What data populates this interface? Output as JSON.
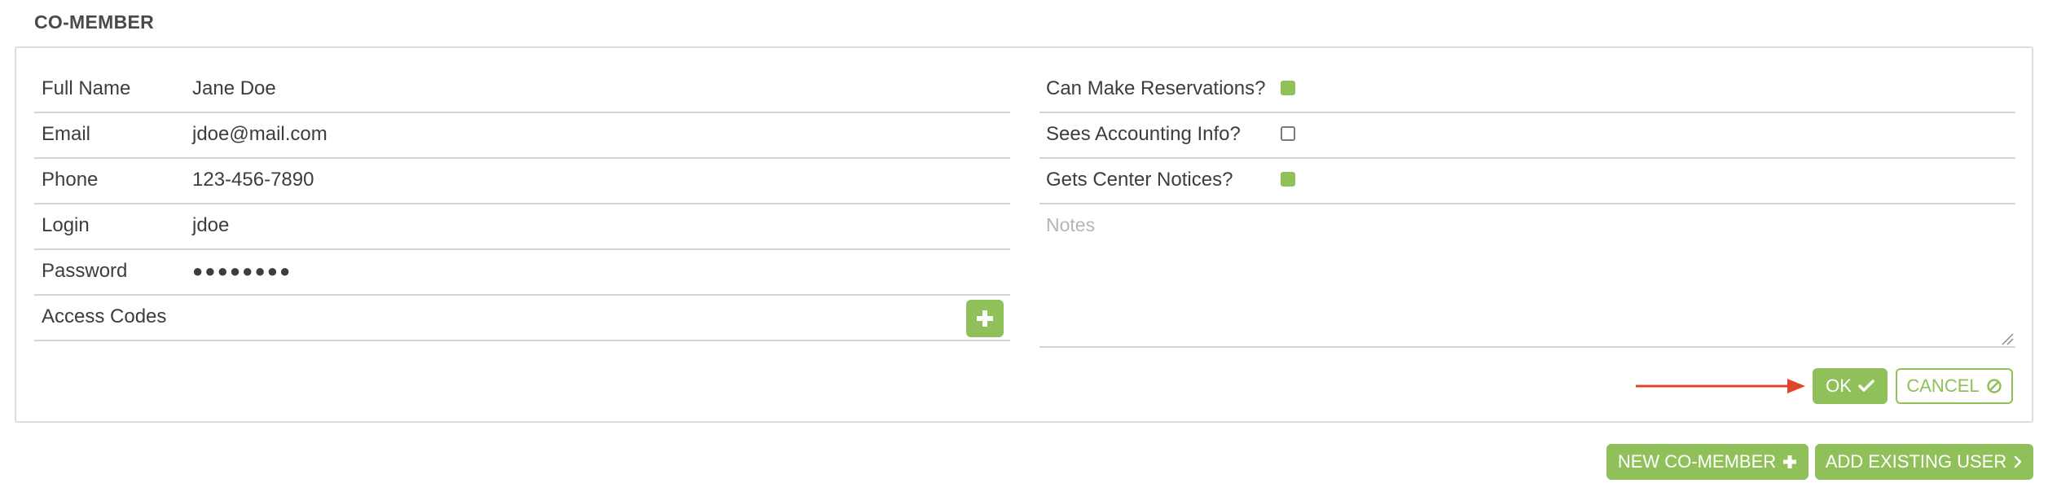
{
  "section": {
    "title": "CO-MEMBER"
  },
  "member_fields": [
    {
      "label": "Full Name",
      "value": "Jane Doe"
    },
    {
      "label": "Email",
      "value": "jdoe@mail.com"
    },
    {
      "label": "Phone",
      "value": "123-456-7890"
    },
    {
      "label": "Login",
      "value": "jdoe"
    },
    {
      "label": "Password",
      "value": "●●●●●●●●"
    },
    {
      "label": "Access Codes",
      "value": ""
    }
  ],
  "permissions": [
    {
      "label": "Can Make Reservations?",
      "checked": true
    },
    {
      "label": "Sees Accounting Info?",
      "checked": false
    },
    {
      "label": "Gets Center Notices?",
      "checked": true
    }
  ],
  "notes": {
    "placeholder": "Notes",
    "value": ""
  },
  "actions": {
    "ok_label": "OK",
    "cancel_label": "CANCEL",
    "new_co_member_label": "NEW CO-MEMBER",
    "add_existing_user_label": "ADD EXISTING USER"
  },
  "icons": {
    "add": "plus-icon",
    "ok": "check-icon",
    "cancel": "ban-icon",
    "new_co_member": "plus-icon",
    "add_existing_user": "chevron-right-icon"
  },
  "colors": {
    "accent": "#8fc05a",
    "annotation_arrow": "#e0452b",
    "border": "#d4d4d4",
    "text": "#3d3d3d"
  }
}
